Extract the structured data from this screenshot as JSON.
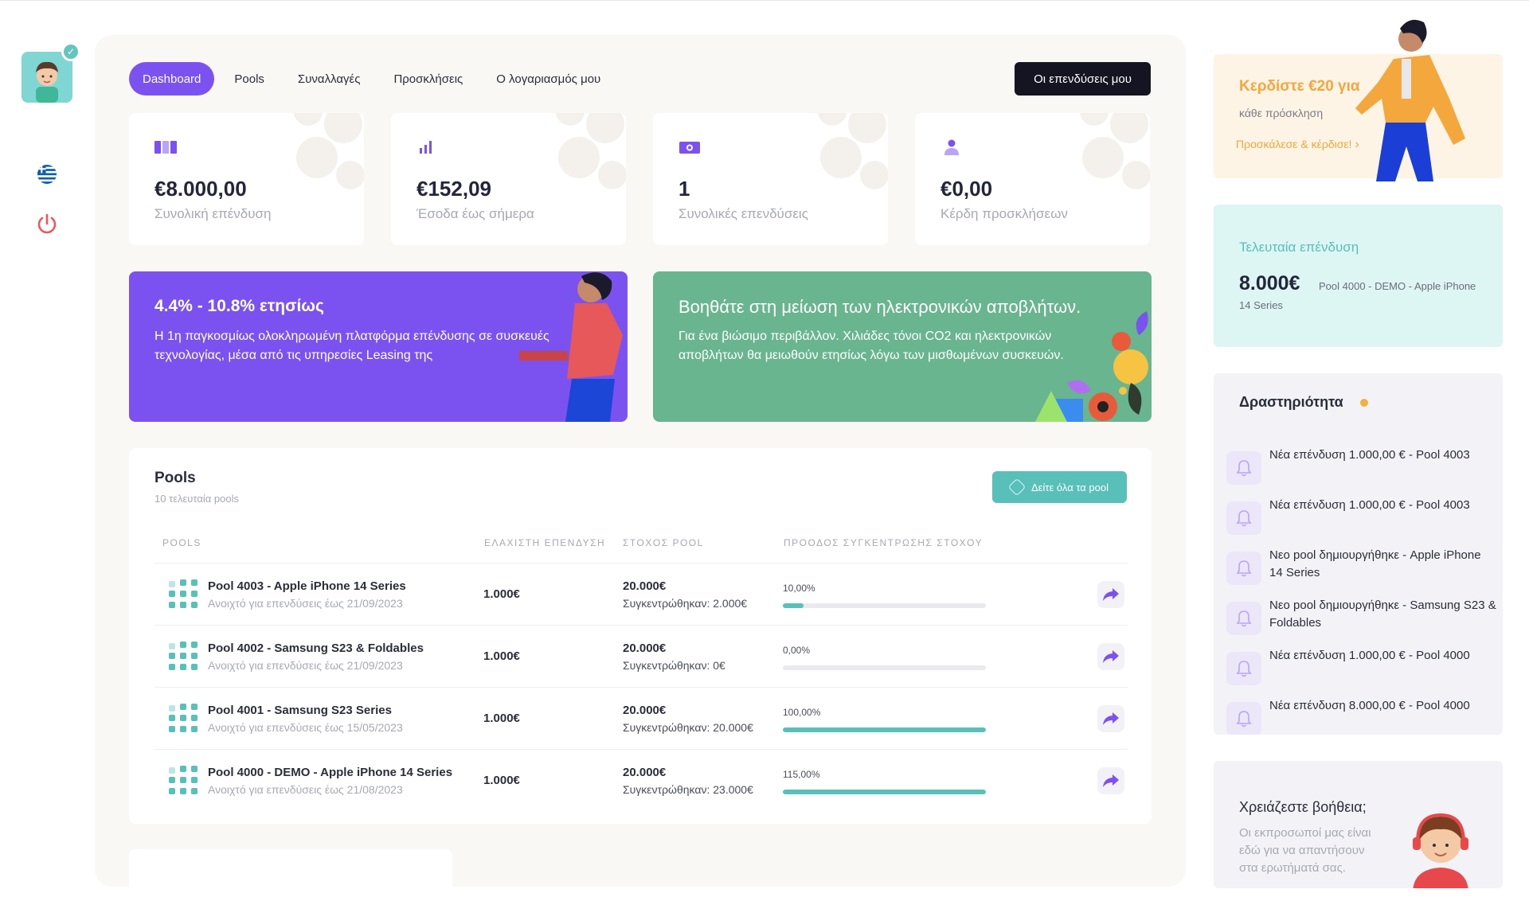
{
  "nav": {
    "tabs": [
      {
        "label": "Dashboard",
        "active": true
      },
      {
        "label": "Pools"
      },
      {
        "label": "Συναλλαγές"
      },
      {
        "label": "Προσκλήσεις"
      },
      {
        "label": "Ο λογαριασμός μου"
      }
    ],
    "my_investments": "Οι επενδύσεις μου"
  },
  "stats": [
    {
      "value": "€8.000,00",
      "label": "Συνολική επένδυση",
      "icon": "columns-icon"
    },
    {
      "value": "€152,09",
      "label": "Έσοδα έως σήμερα",
      "icon": "bar-chart-icon"
    },
    {
      "value": "1",
      "label": "Συνολικές επενδύσεις",
      "icon": "money-icon"
    },
    {
      "value": "€0,00",
      "label": "Κέρδη προσκλήσεων",
      "icon": "user-icon"
    }
  ],
  "banners": {
    "purple": {
      "title": "4.4% - 10.8% ετησίως",
      "text": "Η 1η παγκοσμίως ολοκληρωμένη πλατφόρμα επένδυσης σε συσκευές τεχνολογίας, μέσα από τις υπηρεσίες Leasing της"
    },
    "green": {
      "title": "Βοηθάτε στη μείωση των ηλεκτρονικών αποβλήτων.",
      "text": "Για ένα βιώσιμο περιβάλλον. Χιλιάδες τόνοι CO2 και ηλεκτρονικών αποβλήτων θα μειωθούν ετησίως λόγω των μισθωμένων συσκευών."
    }
  },
  "pools": {
    "title": "Pools",
    "subtitle": "10 τελευταία pools",
    "see_all": "Δείτε όλα τα pool",
    "headers": [
      "POOLS",
      "ΕΛΑΧΙΣΤΗ ΕΠΕΝΔΥΣΗ",
      "ΣΤΟΧΟΣ POOL",
      "ΠΡΟΟΔΟΣ ΣΥΓΚΕΝΤΡΩΣΗΣ ΣΤΟΧΟΥ"
    ],
    "rows": [
      {
        "name": "Pool 4003 - Apple iPhone 14 Series",
        "open": "Ανοιχτό για επενδύσεις έως 21/09/2023",
        "min": "1.000€",
        "target": "20.000€",
        "collected": "Συγκεντρώθηκαν: 2.000€",
        "pct_label": "10,00%",
        "progress": 10
      },
      {
        "name": "Pool 4002 - Samsung S23 & Foldables",
        "open": "Ανοιχτό για επενδύσεις έως 21/09/2023",
        "min": "1.000€",
        "target": "20.000€",
        "collected": "Συγκεντρώθηκαν: 0€",
        "pct_label": "0,00%",
        "progress": 0
      },
      {
        "name": "Pool 4001 - Samsung S23 Series",
        "open": "Ανοιχτό για επενδύσεις έως 15/05/2023",
        "min": "1.000€",
        "target": "20.000€",
        "collected": "Συγκεντρώθηκαν: 20.000€",
        "pct_label": "100,00%",
        "progress": 100
      },
      {
        "name": "Pool 4000 - DEMO - Apple iPhone 14 Series",
        "open": "Ανοιχτό για επενδύσεις έως 21/08/2023",
        "min": "1.000€",
        "target": "20.000€",
        "collected": "Συγκεντρώθηκαν: 23.000€",
        "pct_label": "115,00%",
        "progress": 100
      }
    ]
  },
  "promo": {
    "title": "Κερδίστε €20 για",
    "subtitle": "κάθε πρόσκληση",
    "link": "Προσκάλεσε & κέρδισε!"
  },
  "last_investment": {
    "title": "Τελευταία επένδυση",
    "amount": "8.000€",
    "pool": "Pool 4000 - DEMO - Apple iPhone 14 Series"
  },
  "activity": {
    "title": "Δραστηριότητα",
    "items": [
      "Νέα επένδυση 1.000,00 € - Pool 4003",
      "Νέα επένδυση 1.000,00 € - Pool 4003",
      "Νεο pool δημιουργήθηκε - Apple iPhone 14 Series",
      "Νεο pool δημιουργήθηκε - Samsung S23 & Foldables",
      "Νέα επένδυση 1.000,00 € - Pool 4000",
      "Νέα επένδυση 8.000,00 € - Pool 4000"
    ]
  },
  "help": {
    "title": "Χρειάζεστε βοήθεια;",
    "text": "Οι εκπροσωποί μας είναι εδώ για να απαντήσουν στα ερωτήματά σας."
  },
  "colors": {
    "accent": "#7b52f0",
    "teal": "#58bfb9",
    "green_banner": "#68b58f",
    "promo": "#f3a73c",
    "dark": "#141422"
  }
}
